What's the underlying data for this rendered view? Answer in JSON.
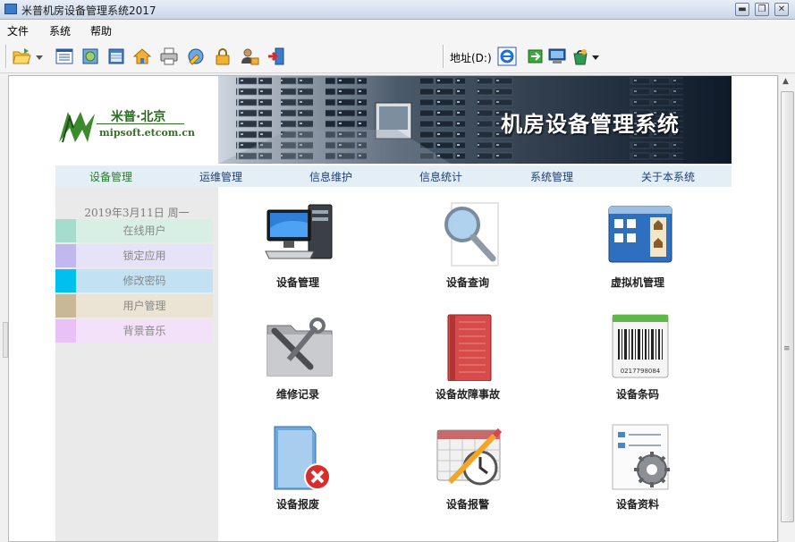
{
  "window": {
    "title": "米普机房设备管理系统2017",
    "controls": [
      "minimize-icon",
      "restore-icon",
      "close-icon"
    ]
  },
  "menu": {
    "items": [
      "文件",
      "系统",
      "帮助"
    ]
  },
  "toolbar": {
    "buttons": [
      "open-folder-icon",
      "dropdown-arrow-icon",
      "list-icon",
      "web-icon",
      "calendar-icon",
      "home-icon",
      "print-icon",
      "globe-tools-icon",
      "lock-icon",
      "user-lock-icon",
      "exit-icon"
    ],
    "address_label": "地址(D:)",
    "address_buttons": [
      "ie-icon",
      "go-arrow-icon",
      "monitor-icon",
      "bag-icon",
      "dropdown-arrow-icon"
    ]
  },
  "logo": {
    "name": "米普·北京",
    "url": "mipsoft.etcom.cn"
  },
  "banner": {
    "title": "机房设备管理系统"
  },
  "nav": {
    "items": [
      "设备管理",
      "运维管理",
      "信息维护",
      "信息统计",
      "系统管理",
      "关于本系统"
    ]
  },
  "sidebar": {
    "date": "2019年3月11日  周一",
    "items": [
      {
        "label": "在线用户",
        "color": "#a6dccb",
        "bg": "#d8efe6"
      },
      {
        "label": "锁定应用",
        "color": "#c1b9ee",
        "bg": "#e6e2f7"
      },
      {
        "label": "修改密码",
        "color": "#00c0f0",
        "bg": "#c2e2f4"
      },
      {
        "label": "用户管理",
        "color": "#c9b896",
        "bg": "#ebe3d4"
      },
      {
        "label": "背景音乐",
        "color": "#e8c2f6",
        "bg": "#f3e1f9"
      }
    ]
  },
  "tiles": [
    {
      "label": "设备管理",
      "icon": "computer-icon"
    },
    {
      "label": "设备查询",
      "icon": "magnifier-icon"
    },
    {
      "label": "虚拟机管理",
      "icon": "virtual-machine-icon"
    },
    {
      "label": "维修记录",
      "icon": "tools-folder-icon"
    },
    {
      "label": "设备故障事故",
      "icon": "notebook-icon"
    },
    {
      "label": "设备条码",
      "icon": "barcode-icon"
    },
    {
      "label": "设备报废",
      "icon": "folder-delete-icon"
    },
    {
      "label": "设备报警",
      "icon": "alarm-calendar-icon"
    },
    {
      "label": "设备资料",
      "icon": "document-gear-icon"
    }
  ],
  "barcode_number": "0217798084"
}
